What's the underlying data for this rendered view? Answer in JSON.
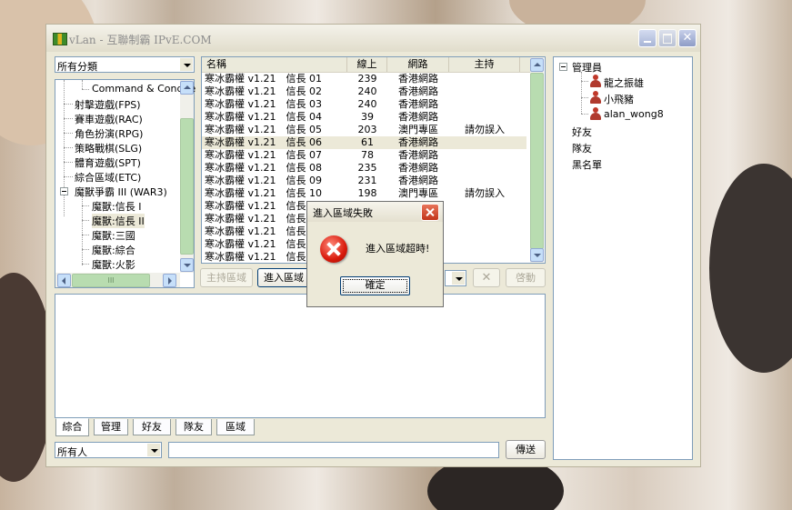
{
  "window": {
    "title": "vLan - 互聯制霸 IPvE.COM"
  },
  "category_combo": {
    "value": "所有分類"
  },
  "category_tree": {
    "items": [
      {
        "label": "Command & Conque"
      },
      {
        "label": "射擊遊戲(FPS)"
      },
      {
        "label": "賽車遊戲(RAC)"
      },
      {
        "label": "角色扮演(RPG)"
      },
      {
        "label": "策略戰棋(SLG)"
      },
      {
        "label": "體育遊戲(SPT)"
      },
      {
        "label": "綜合區域(ETC)"
      },
      {
        "label": "魔獸爭霸 III (WAR3)"
      },
      {
        "label": "魔獸:信長 I"
      },
      {
        "label": "魔獸:信長 II"
      },
      {
        "label": "魔獸:三國"
      },
      {
        "label": "魔獸:綜合"
      },
      {
        "label": "魔獸:火影"
      }
    ],
    "hscroll_thumb_label": "III"
  },
  "room_list": {
    "headers": [
      "名稱",
      "線上",
      "網路",
      "主持"
    ],
    "rows": [
      {
        "name": "寒冰霸權 v1.21　信長 01",
        "online": "239",
        "network": "香港網路",
        "host": ""
      },
      {
        "name": "寒冰霸權 v1.21　信長 02",
        "online": "240",
        "network": "香港網路",
        "host": ""
      },
      {
        "name": "寒冰霸權 v1.21　信長 03",
        "online": "240",
        "network": "香港網路",
        "host": ""
      },
      {
        "name": "寒冰霸權 v1.21　信長 04",
        "online": "39",
        "network": "香港網路",
        "host": ""
      },
      {
        "name": "寒冰霸權 v1.21　信長 05",
        "online": "203",
        "network": "澳門專區",
        "host": "請勿誤入"
      },
      {
        "name": "寒冰霸權 v1.21　信長 06",
        "online": "61",
        "network": "香港網路",
        "host": ""
      },
      {
        "name": "寒冰霸權 v1.21　信長 07",
        "online": "78",
        "network": "香港網路",
        "host": ""
      },
      {
        "name": "寒冰霸權 v1.21　信長 08",
        "online": "235",
        "network": "香港網路",
        "host": ""
      },
      {
        "name": "寒冰霸權 v1.21　信長 09",
        "online": "231",
        "network": "香港網路",
        "host": ""
      },
      {
        "name": "寒冰霸權 v1.21　信長 10",
        "online": "198",
        "network": "澳門專區",
        "host": "請勿誤入"
      },
      {
        "name": "寒冰霸權 v1.21　信長",
        "online": "",
        "network": "",
        "host": ""
      },
      {
        "name": "寒冰霸權 v1.21　信長",
        "online": "",
        "network": "",
        "host": ""
      },
      {
        "name": "寒冰霸權 v1.21　信長",
        "online": "",
        "network": "",
        "host": ""
      },
      {
        "name": "寒冰霸權 v1.21　信長",
        "online": "",
        "network": "",
        "host": ""
      },
      {
        "name": "寒冰霸權 v1.21　信長",
        "online": "",
        "network": "",
        "host": ""
      }
    ]
  },
  "room_toolbar": {
    "host_area": "主持區域",
    "enter_area": "進入區域",
    "stop_label": "✕",
    "start_label": "啓動"
  },
  "chat_tabs": [
    "綜合",
    "管理",
    "好友",
    "隊友",
    "區域"
  ],
  "chat_input": {
    "recipient": "所有人",
    "send_label": "傳送",
    "message": ""
  },
  "friends_tree": {
    "admin_group": "管理員",
    "admins": [
      "龍之振雄",
      "小飛豬",
      "alan_wong8"
    ],
    "groups": [
      "好友",
      "隊友",
      "黑名單"
    ]
  },
  "dialog": {
    "title": "進入區域失敗",
    "message": "進入區域超時!",
    "ok_label": "確定"
  },
  "colors": {
    "window_bg": "#ece9d8",
    "error_red": "#d91a0c",
    "scroll_thumb": "#b8dcb0"
  }
}
